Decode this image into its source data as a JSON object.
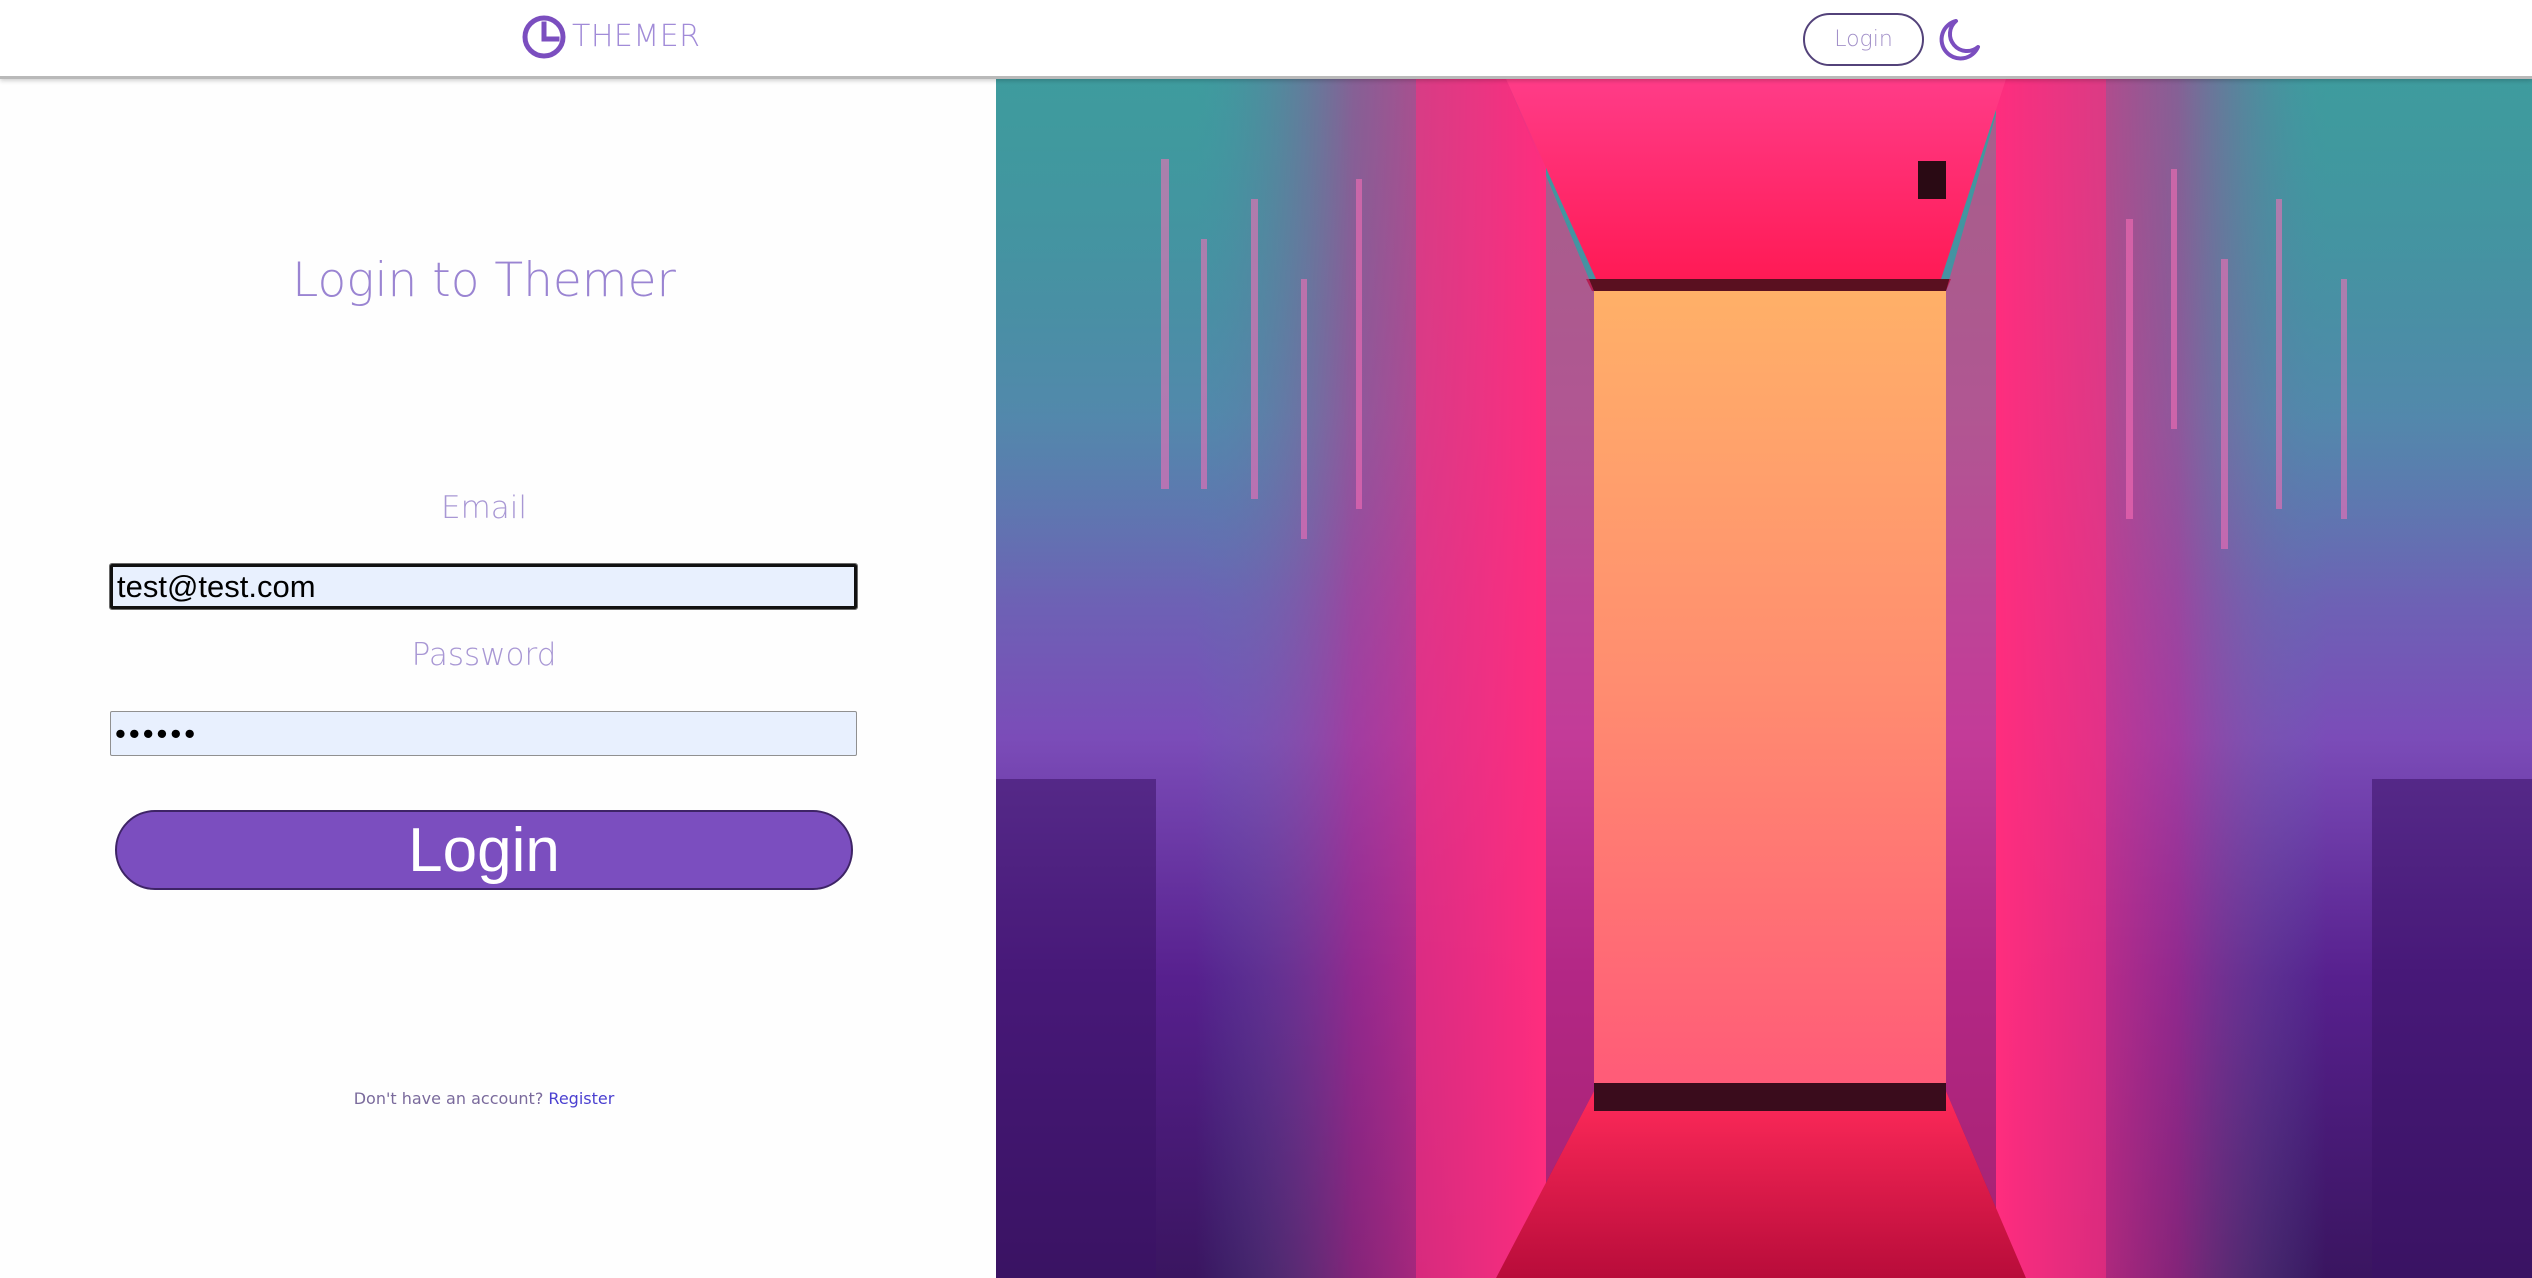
{
  "header": {
    "brand_name": "THEMER",
    "login_label": "Login",
    "logo_icon": "pie-chart-logo-icon",
    "theme_icon": "moon-icon"
  },
  "form": {
    "title": "Login to Themer",
    "email_label": "Email",
    "email_value": "test@test.com",
    "password_label": "Password",
    "password_value": "••••••",
    "submit_label": "Login",
    "register_prompt": "Don't have an account?",
    "register_link": "Register"
  },
  "colors": {
    "accent": "#7b4ebf",
    "brand_text": "#a18bd8",
    "input_autofill_bg": "#e8f0fe",
    "link": "#4a3fd0"
  }
}
